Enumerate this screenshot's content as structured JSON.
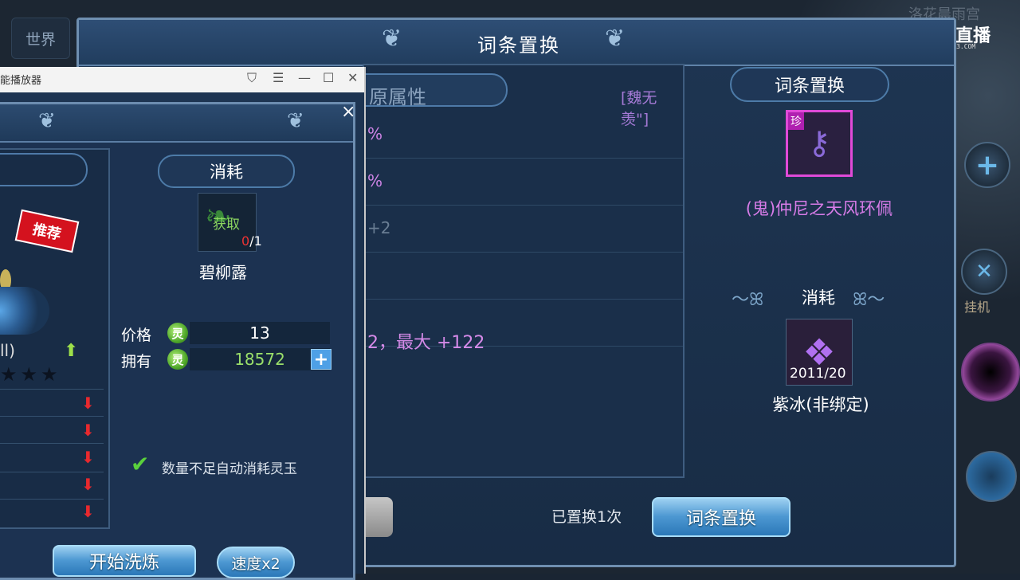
{
  "background": {
    "world_button": "世界",
    "top_right_text": "洛花晨雨宫"
  },
  "logo": {
    "text": "直播",
    "sub": "CC.163.COM"
  },
  "side": {
    "hang_label": "挂机"
  },
  "main": {
    "title": "词条置换",
    "center": {
      "head_label": "原属性",
      "head_right": "[魏无羡\"]",
      "rows": [
        "%",
        "%",
        "+2",
        "",
        ""
      ],
      "big_row": "2，最大 +122"
    },
    "right": {
      "tab_label": "词条置换",
      "item_badge": "珍",
      "item_name": "(鬼)仲尼之天风环佩",
      "consume_label": "消耗",
      "consume_item_count": "2011/20",
      "consume_item_name": "紫冰(非绑定)"
    },
    "replace_count": "已置换1次",
    "replace_button": "词条置换"
  },
  "media_window": {
    "title": "能播放器",
    "close_x": "×"
  },
  "refine": {
    "recommend": "推荐",
    "paren_text": "ll)",
    "stars": "★★★",
    "consume_label": "消耗",
    "slot_get": "获取",
    "slot_qty_red": "0",
    "slot_qty_rest": "/1",
    "slot_name": "碧柳露",
    "price_label": "价格",
    "price_value": "13",
    "own_label": "拥有",
    "own_value": "18572",
    "jade_glyph": "灵",
    "auto_label": "数量不足自动消耗灵玉",
    "start_button": "开始洗炼",
    "speed_button": "速度x2"
  },
  "colors": {
    "accent_blue": "#4d98d2",
    "rare_purple": "#d77ce8",
    "panel_bg": "#1c3251"
  }
}
